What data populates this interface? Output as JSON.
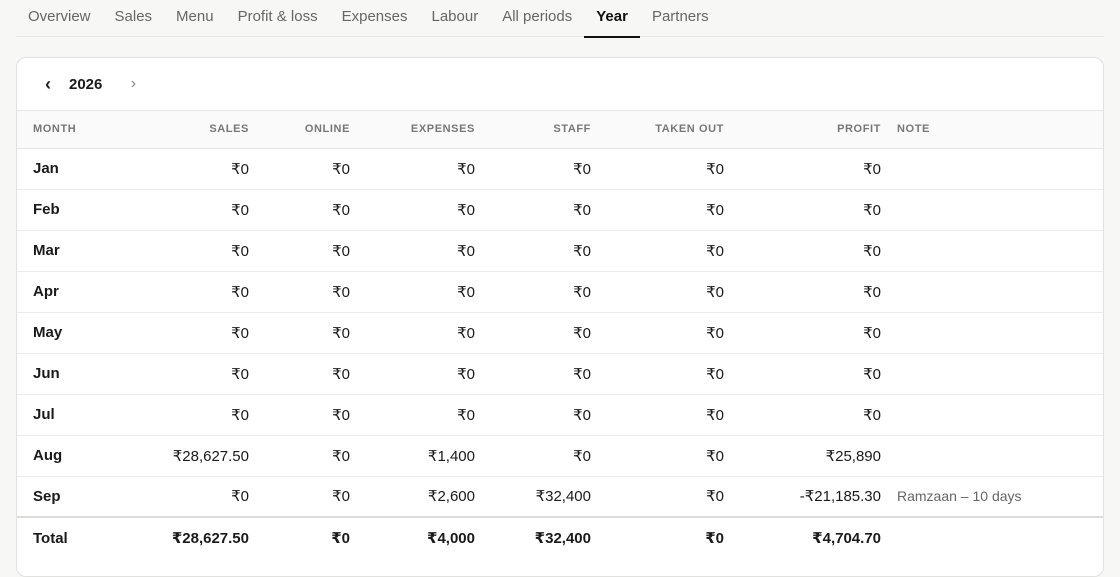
{
  "tabs": [
    {
      "label": "Overview"
    },
    {
      "label": "Sales"
    },
    {
      "label": "Menu"
    },
    {
      "label": "Profit & loss"
    },
    {
      "label": "Expenses"
    },
    {
      "label": "Labour"
    },
    {
      "label": "All periods"
    },
    {
      "label": "Year",
      "active": true
    },
    {
      "label": "Partners"
    }
  ],
  "year_nav": {
    "prev_icon": "chevron-left-icon",
    "next_icon": "chevron-right-icon",
    "year": "2026"
  },
  "table": {
    "headers": {
      "month": "MONTH",
      "sales": "SALES",
      "online": "ONLINE",
      "expenses": "EXPENSES",
      "staff": "STAFF",
      "taken_out": "TAKEN OUT",
      "profit": "PROFIT",
      "note": "NOTE"
    },
    "rows": [
      {
        "month": "Jan",
        "sales": "₹0",
        "online": "₹0",
        "expenses": "₹0",
        "staff": "₹0",
        "taken_out": "₹0",
        "profit": "₹0",
        "note": ""
      },
      {
        "month": "Feb",
        "sales": "₹0",
        "online": "₹0",
        "expenses": "₹0",
        "staff": "₹0",
        "taken_out": "₹0",
        "profit": "₹0",
        "note": ""
      },
      {
        "month": "Mar",
        "sales": "₹0",
        "online": "₹0",
        "expenses": "₹0",
        "staff": "₹0",
        "taken_out": "₹0",
        "profit": "₹0",
        "note": ""
      },
      {
        "month": "Apr",
        "sales": "₹0",
        "online": "₹0",
        "expenses": "₹0",
        "staff": "₹0",
        "taken_out": "₹0",
        "profit": "₹0",
        "note": ""
      },
      {
        "month": "May",
        "sales": "₹0",
        "online": "₹0",
        "expenses": "₹0",
        "staff": "₹0",
        "taken_out": "₹0",
        "profit": "₹0",
        "note": ""
      },
      {
        "month": "Jun",
        "sales": "₹0",
        "online": "₹0",
        "expenses": "₹0",
        "staff": "₹0",
        "taken_out": "₹0",
        "profit": "₹0",
        "note": ""
      },
      {
        "month": "Jul",
        "sales": "₹0",
        "online": "₹0",
        "expenses": "₹0",
        "staff": "₹0",
        "taken_out": "₹0",
        "profit": "₹0",
        "note": ""
      },
      {
        "month": "Aug",
        "sales": "₹28,627.50",
        "online": "₹0",
        "expenses": "₹1,400",
        "staff": "₹0",
        "taken_out": "₹0",
        "profit": "₹25,890",
        "note": ""
      },
      {
        "month": "Sep",
        "sales": "₹0",
        "online": "₹0",
        "expenses": "₹2,600",
        "staff": "₹32,400",
        "taken_out": "₹0",
        "profit": "-₹21,185.30",
        "note": "Ramzaan – 10 days"
      }
    ],
    "total": {
      "month": "Total",
      "sales": "₹28,627.50",
      "online": "₹0",
      "expenses": "₹4,000",
      "staff": "₹32,400",
      "taken_out": "₹0",
      "profit": "₹4,704.70"
    }
  }
}
